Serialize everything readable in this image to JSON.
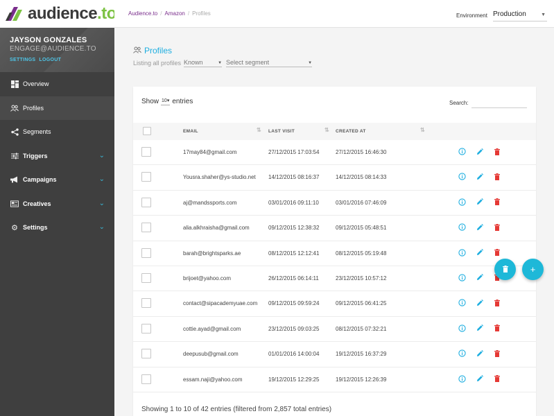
{
  "brand": {
    "name": "audience",
    "suffix": ".to"
  },
  "user": {
    "name": "JAYSON GONZALES",
    "email": "ENGAGE@AUDIENCE.TO",
    "settings_link": "SETTINGS",
    "logout_link": "LOGOUT"
  },
  "nav": [
    {
      "label": "Overview",
      "icon": "dashboard-icon",
      "active": false
    },
    {
      "label": "Profiles",
      "icon": "people-icon",
      "active": true
    },
    {
      "label": "Segments",
      "icon": "share-icon",
      "active": false
    },
    {
      "label": "Triggers",
      "icon": "sliders-icon",
      "active": false
    },
    {
      "label": "Campaigns",
      "icon": "megaphone-icon",
      "active": false
    },
    {
      "label": "Creatives",
      "icon": "creatives-icon",
      "active": false
    },
    {
      "label": "Settings",
      "icon": "gear-icon",
      "active": false
    }
  ],
  "breadcrumb": {
    "root": "Audience.to",
    "mid": "Amazon",
    "current": "Profiles"
  },
  "environment": {
    "label": "Environment",
    "value": "Production"
  },
  "page": {
    "title": "Profiles",
    "listing_label": "Listing all profiles",
    "filter_known": "Known",
    "segment_placeholder": "Select segment"
  },
  "table": {
    "show_label": "Show",
    "length": "10",
    "entries_label": "entries",
    "search_label": "Search:",
    "columns": {
      "email": "EMAIL",
      "last_visit": "LAST VISIT",
      "created_at": "CREATED AT"
    },
    "rows": [
      {
        "email": "17may84@gmail.com",
        "last_visit": "27/12/2015 17:03:54",
        "created_at": "27/12/2015 16:46:30"
      },
      {
        "email": "Yousra.shaher@ys-studio.net",
        "last_visit": "14/12/2015 08:16:37",
        "created_at": "14/12/2015 08:14:33"
      },
      {
        "email": "aj@mandssports.com",
        "last_visit": "03/01/2016 09:11:10",
        "created_at": "03/01/2016 07:46:09"
      },
      {
        "email": "alia.alkhraisha@gmail.com",
        "last_visit": "09/12/2015 12:38:32",
        "created_at": "09/12/2015 05:48:51"
      },
      {
        "email": "barah@brightsparks.ae",
        "last_visit": "08/12/2015 12:12:41",
        "created_at": "08/12/2015 05:19:48"
      },
      {
        "email": "brijoet@yahoo.com",
        "last_visit": "26/12/2015 06:14:11",
        "created_at": "23/12/2015 10:57:12"
      },
      {
        "email": "contact@sipacademyuae.com",
        "last_visit": "09/12/2015 09:59:24",
        "created_at": "09/12/2015 06:41:25"
      },
      {
        "email": "cottie.ayad@gmail.com",
        "last_visit": "23/12/2015 09:03:25",
        "created_at": "08/12/2015 07:32:21"
      },
      {
        "email": "deepusub@gmail.com",
        "last_visit": "01/01/2016 14:00:04",
        "created_at": "19/12/2015 16:37:29"
      },
      {
        "email": "essam.naji@yahoo.com",
        "last_visit": "19/12/2015 12:29:25",
        "created_at": "19/12/2015 12:26:39"
      }
    ],
    "footer": "Showing 1 to 10 of 42 entries (filtered from 2,857 total entries)"
  },
  "fab": {
    "add_symbol": "+"
  },
  "colors": {
    "accent": "#1eb8d8",
    "delete": "#e53935",
    "edit": "#1eaee0",
    "brand_green": "#7cc242"
  }
}
